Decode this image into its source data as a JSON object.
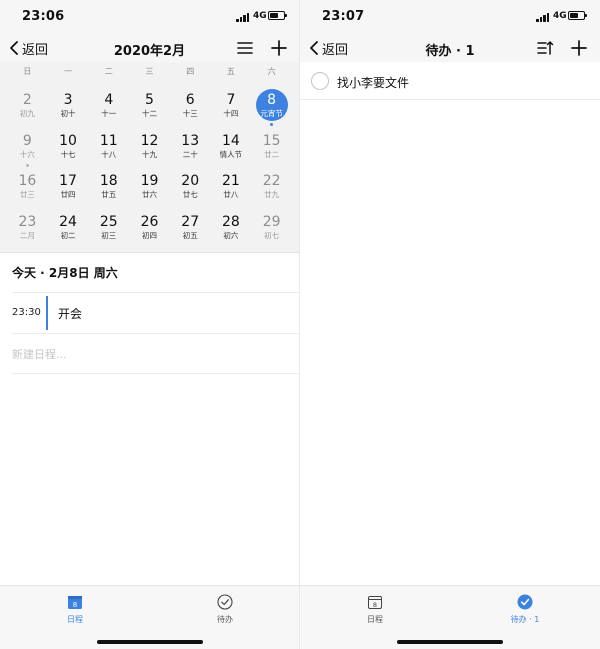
{
  "left": {
    "status": {
      "time": "23:06",
      "network": "4G"
    },
    "nav": {
      "back_label": "返回",
      "title": "2020年2月",
      "icons": [
        "list-icon",
        "plus-icon"
      ]
    },
    "weekdays": [
      "日",
      "一",
      "二",
      "三",
      "四",
      "五",
      "六"
    ],
    "weeks": [
      [
        {
          "n": "2",
          "s": "初九",
          "weekend": true
        },
        {
          "n": "3",
          "s": "初十"
        },
        {
          "n": "4",
          "s": "十一"
        },
        {
          "n": "5",
          "s": "十二"
        },
        {
          "n": "6",
          "s": "十三"
        },
        {
          "n": "7",
          "s": "十四"
        },
        {
          "n": "8",
          "s": "元宵节",
          "weekend": true,
          "selected": true,
          "dot": true
        }
      ],
      [
        {
          "n": "9",
          "s": "十六",
          "weekend": true,
          "dot": true
        },
        {
          "n": "10",
          "s": "十七"
        },
        {
          "n": "11",
          "s": "十八"
        },
        {
          "n": "12",
          "s": "十九"
        },
        {
          "n": "13",
          "s": "二十"
        },
        {
          "n": "14",
          "s": "情人节"
        },
        {
          "n": "15",
          "s": "廿二",
          "weekend": true
        }
      ],
      [
        {
          "n": "16",
          "s": "廿三",
          "weekend": true
        },
        {
          "n": "17",
          "s": "廿四"
        },
        {
          "n": "18",
          "s": "廿五"
        },
        {
          "n": "19",
          "s": "廿六"
        },
        {
          "n": "20",
          "s": "廿七"
        },
        {
          "n": "21",
          "s": "廿八"
        },
        {
          "n": "22",
          "s": "廿九",
          "weekend": true
        }
      ],
      [
        {
          "n": "23",
          "s": "二月",
          "weekend": true
        },
        {
          "n": "24",
          "s": "初二"
        },
        {
          "n": "25",
          "s": "初三"
        },
        {
          "n": "26",
          "s": "初四"
        },
        {
          "n": "27",
          "s": "初五"
        },
        {
          "n": "28",
          "s": "初六"
        },
        {
          "n": "29",
          "s": "初七",
          "weekend": true
        }
      ]
    ],
    "today": {
      "heading": "今天 · 2月8日 周六"
    },
    "event": {
      "time": "23:30",
      "title": "开会"
    },
    "new_placeholder": "新建日程..."
  },
  "right": {
    "status": {
      "time": "23:07",
      "network": "4G"
    },
    "nav": {
      "back_label": "返回",
      "title": "待办 · 1",
      "icons": [
        "sort-icon",
        "plus-icon"
      ]
    },
    "todos": [
      {
        "text": "找小李要文件",
        "done": false
      }
    ]
  },
  "tabs": {
    "left": [
      {
        "label": "日程",
        "icon": "calendar-icon",
        "active": true,
        "badge": "8"
      },
      {
        "label": "待办",
        "icon": "check-circle-icon",
        "active": false
      }
    ],
    "right": [
      {
        "label": "日程",
        "icon": "calendar-icon",
        "active": false,
        "badge": "8"
      },
      {
        "label": "待办 · 1",
        "icon": "check-circle-icon",
        "active": true
      }
    ]
  },
  "colors": {
    "accent": "#3e82e0",
    "calendar_bg": "#f2f2f2",
    "muted": "#8d8d8d"
  }
}
